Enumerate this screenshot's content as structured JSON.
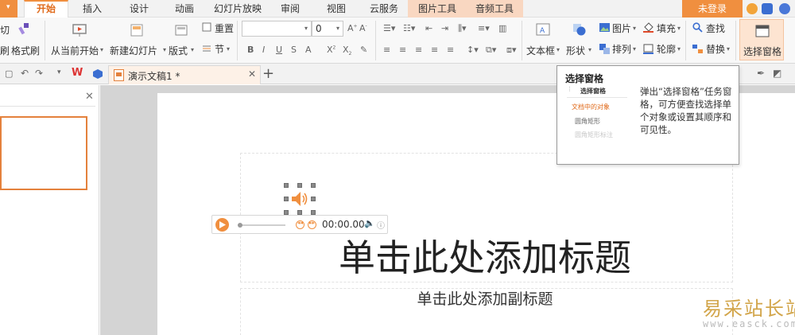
{
  "menu": {
    "tabs": [
      {
        "label": "开始",
        "active": true
      },
      {
        "label": "插入"
      },
      {
        "label": "设计"
      },
      {
        "label": "动画"
      },
      {
        "label": "幻灯片放映"
      },
      {
        "label": "审阅"
      },
      {
        "label": "视图"
      },
      {
        "label": "云服务"
      },
      {
        "label": "图片工具"
      },
      {
        "label": "音频工具"
      }
    ],
    "login": "未登录"
  },
  "ribbon": {
    "clip_top": "切",
    "clip_bottom": "刷",
    "format_painter": "格式刷",
    "from_current": "从当前开始",
    "new_slide": "新建幻灯片",
    "layout": "版式",
    "reset": "重置",
    "section": "节",
    "font_size": "0",
    "textbox": "文本框",
    "shape": "形状",
    "picture": "图片",
    "arrange": "排列",
    "fill": "填充",
    "outline": "轮廓",
    "find": "查找",
    "replace": "替换",
    "selection_pane": "选择窗格"
  },
  "doc_tab": {
    "title": "演示文稿1 *"
  },
  "slide": {
    "title_placeholder": "单击此处添加标题",
    "subtitle_placeholder": "单击此处添加副标题"
  },
  "player": {
    "time": "00:00.00"
  },
  "tooltip": {
    "title": "选择窗格",
    "mini_header": "选择窗格",
    "mini_section": "文档中的对象",
    "mini_item_1": "圆角矩形",
    "mini_item_2": "圆角矩形标注",
    "description": "弹出“选择窗格”任务窗格，可方便查找选择单个对象或设置其顺序和可见性。"
  },
  "watermark": {
    "site_name": "易采站长站",
    "url": "www.easck.com"
  },
  "colors": {
    "accent": "#f08f3f",
    "tab_active_text": "#e06a1a",
    "context_tools_bg": "#f9d7c1",
    "selection_border": "#e4813c"
  }
}
